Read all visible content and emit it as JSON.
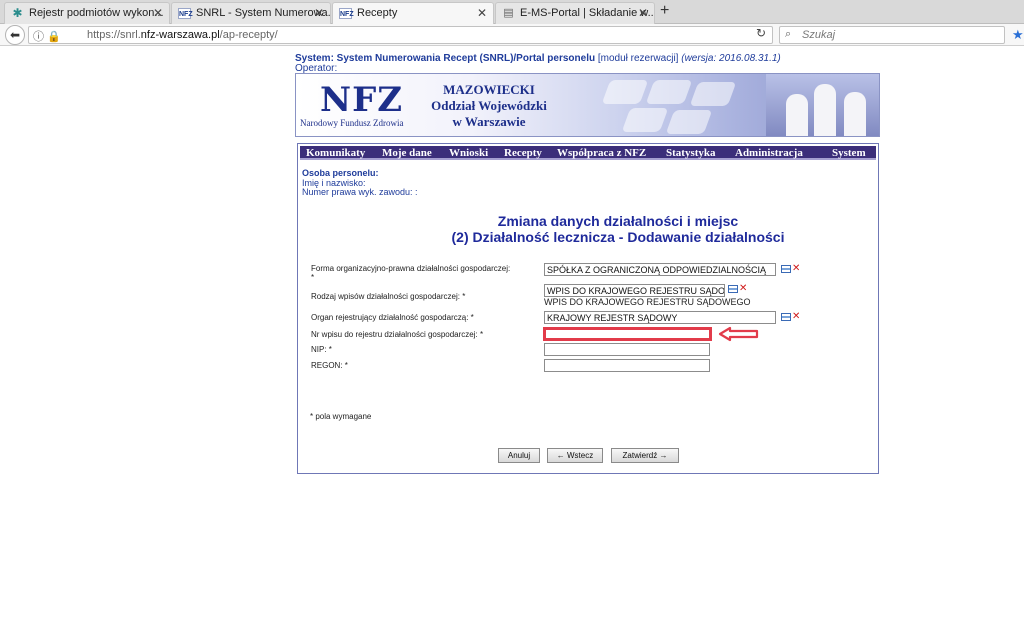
{
  "browser": {
    "tabs": [
      {
        "title": "Rejestr podmiotów wykon...",
        "icon": "gear-icon"
      },
      {
        "title": "SNRL - System Numerowa...",
        "icon": "nfz-icon"
      },
      {
        "title": "Recepty",
        "icon": "nfz-icon",
        "active": true
      },
      {
        "title": "E-MS-Portal | Składanie w...",
        "icon": "document-icon"
      }
    ],
    "new_tab": "+",
    "url_prefix": "https://snrl.",
    "url_domain": "nfz-warszawa.pl",
    "url_path": "/ap-recepty/",
    "search_placeholder": "Szukaj"
  },
  "page": {
    "system_label": "System: System Numerowania Recept (SNRL)/Portal personelu",
    "module_label": "[moduł rezerwacji]",
    "version_label": "(wersja: 2016.08.31.1)",
    "operator_label": "Operator:",
    "banner": {
      "logo": "NFZ",
      "logo_sub": "Narodowy Fundusz Zdrowia",
      "line1": "MAZOWIECKI",
      "line2": "Oddział Wojewódzki",
      "line3": "w Warszawie"
    },
    "menu": [
      "Komunikaty",
      "Moje dane",
      "Wnioski",
      "Recepty",
      "Współpraca z NFZ",
      "Statystyka",
      "Administracja",
      "System"
    ],
    "person": {
      "heading": "Osoba personelu:",
      "name_label": "Imię i nazwisko:",
      "license_label": "Numer prawa wyk. zawodu: :"
    },
    "title_line1": "Zmiana danych działalności i miejsc",
    "title_line2": "(2) Działalność lecznicza - Dodawanie działalności",
    "form": {
      "forma_label": "Forma organizacyjno-prawna działalności gospodarczej:",
      "forma_star": "*",
      "forma_value": "SPÓŁKA Z OGRANICZONĄ ODPOWIEDZIALNOŚCIĄ",
      "rodzaj_label": "Rodzaj wpisów działalności gospodarczej: *",
      "rodzaj_value": "WPIS DO KRAJOWEGO REJESTRU SĄDOWEGO",
      "rodzaj_subtext": "WPIS DO KRAJOWEGO REJESTRU SĄDOWEGO",
      "organ_label": "Organ rejestrujący działalność gospodarczą: *",
      "organ_value": "KRAJOWY REJESTR SĄDOWY",
      "nr_label": "Nr wpisu do rejestru działalności gospodarczej: *",
      "nr_value": "",
      "nip_label": "NIP: *",
      "nip_value": "",
      "regon_label": "REGON: *",
      "regon_value": "",
      "required_note": "* pola wymagane"
    },
    "buttons": {
      "cancel": "Anuluj",
      "back": "← Wstecz",
      "confirm": "Zatwierdź →"
    },
    "colors": {
      "menu_bg": "#3b2e7a",
      "link_blue": "#1f3c9b",
      "highlight_red": "#e23b4a"
    }
  }
}
